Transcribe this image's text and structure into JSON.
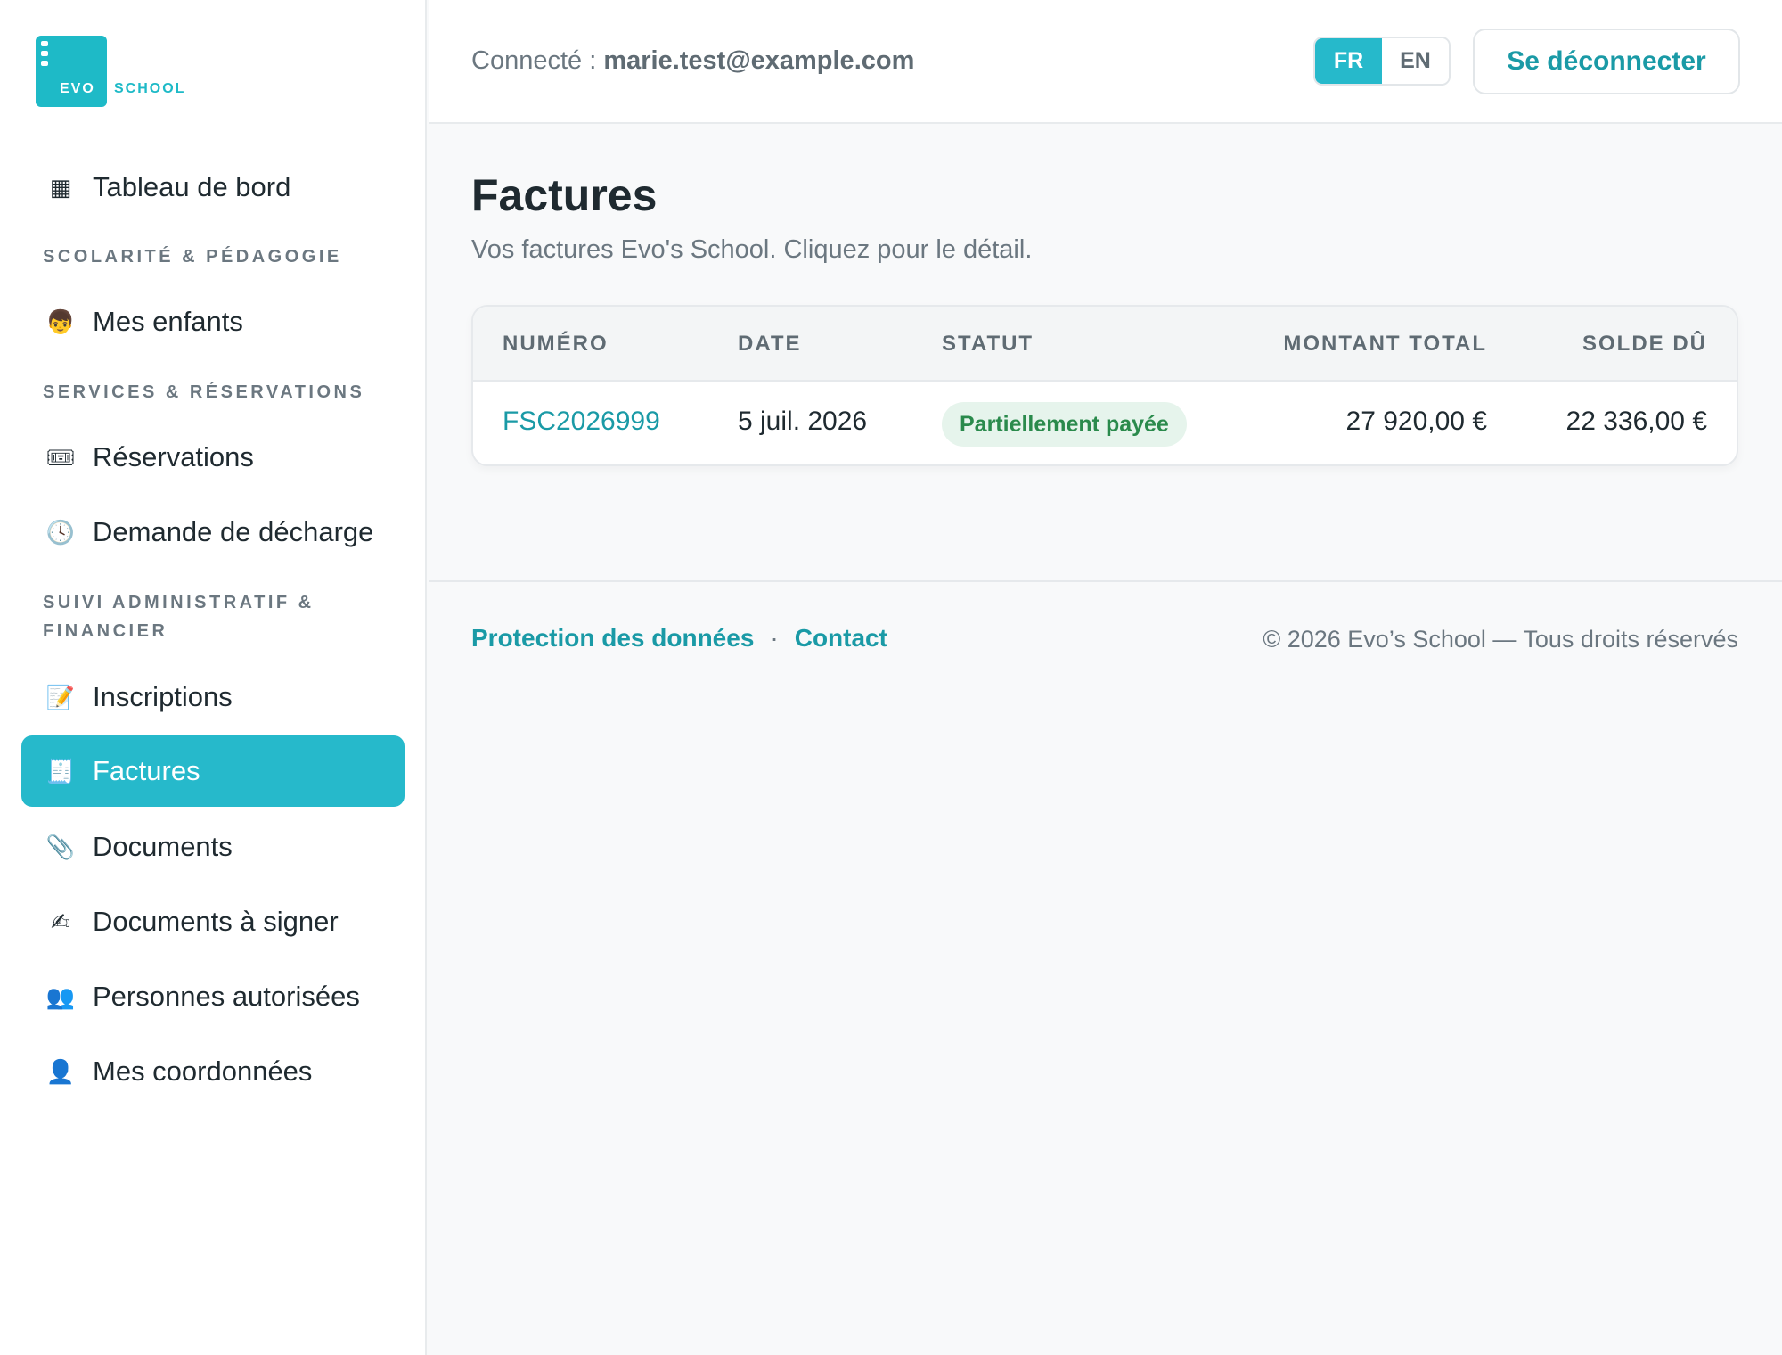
{
  "brand": {
    "logo_text_left": "EVO",
    "logo_text_right": "SCHOOL",
    "accent_color": "#26b9cb"
  },
  "sidebar": {
    "dashboard": {
      "icon": "calendar-grid-icon",
      "label": "Tableau de bord"
    },
    "sections": [
      "SCOLARITÉ & PÉDAGOGIE",
      "SERVICES & RÉSERVATIONS",
      "SUIVI ADMINISTRATIF & FINANCIER"
    ],
    "items": [
      {
        "icon": "child-icon",
        "label": "Mes enfants"
      },
      {
        "icon": "ticket-icon",
        "label": "Réservations"
      },
      {
        "icon": "clock-icon",
        "label": "Demande de décharge"
      },
      {
        "icon": "memo-icon",
        "label": "Inscriptions"
      },
      {
        "icon": "receipt-icon",
        "label": "Factures",
        "active": true
      },
      {
        "icon": "paperclip-icon",
        "label": "Documents"
      },
      {
        "icon": "writing-hand-icon",
        "label": "Documents à signer"
      },
      {
        "icon": "people-icon",
        "label": "Personnes autorisées"
      },
      {
        "icon": "person-icon",
        "label": "Mes coordonnées"
      }
    ]
  },
  "header": {
    "connected_prefix": "Connecté : ",
    "user_email": "marie.test@example.com",
    "lang": {
      "fr": "FR",
      "en": "EN",
      "selected": "FR"
    },
    "logout_label": "Se déconnecter"
  },
  "main": {
    "title": "Factures",
    "subtitle": "Vos factures Evo's School. Cliquez pour le détail.",
    "table": {
      "columns": [
        "NUMÉRO",
        "DATE",
        "STATUT",
        "MONTANT TOTAL",
        "SOLDE DÛ"
      ],
      "rows": [
        {
          "number": "FSC2026999",
          "date": "5 juil. 2026",
          "status": "Partiellement payée",
          "total": "27 920,00 €",
          "balance": "22 336,00 €"
        }
      ]
    }
  },
  "footer": {
    "privacy": "Protection des données",
    "separator": "·",
    "contact": "Contact",
    "copyright": "© 2026 Evo’s School — Tous droits réservés"
  }
}
